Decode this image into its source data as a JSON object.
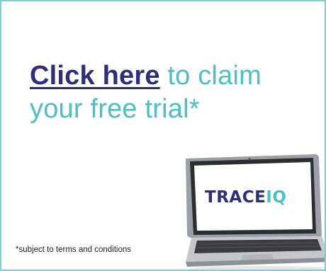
{
  "ad": {
    "cta_link": "Click here",
    "cta_rest": " to claim your free trial*",
    "disclaimer": "*subject to terms and conditions",
    "brand_main": "TRACE",
    "brand_accent": "IQ"
  },
  "colors": {
    "border": "#7fcfd0",
    "link": "#2f2e7a",
    "teal": "#4ebfc4"
  }
}
